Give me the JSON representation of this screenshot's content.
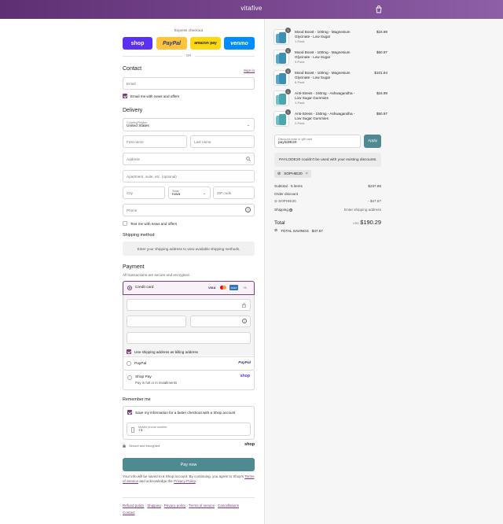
{
  "header": {
    "brand": "vitafive"
  },
  "express": {
    "label": "Express checkout",
    "buttons": {
      "shop": "shop",
      "paypal": "PayPal",
      "amazon": "amazon pay",
      "venmo": "venmo"
    },
    "or": "OR"
  },
  "contact": {
    "title": "Contact",
    "sign_in": "Sign in",
    "email_placeholder": "Email",
    "news_label": "Email me with news and offers"
  },
  "delivery": {
    "title": "Delivery",
    "country_label": "Country/Region",
    "country_value": "United States",
    "first_name": "First name",
    "last_name": "Last name",
    "address": "Address",
    "apartment": "Apartment, suite, etc. (optional)",
    "city": "City",
    "state_label": "State",
    "state_value": "Iowa",
    "zip": "ZIP code",
    "phone": "Phone",
    "text_label": "Text me with news and offers"
  },
  "shipping": {
    "title": "Shipping method",
    "notice": "Enter your shipping address to view available shipping methods."
  },
  "payment": {
    "title": "Payment",
    "subtitle": "All transactions are secure and encrypted.",
    "credit_card": "Credit card",
    "card_badges": {
      "visa": "VISA",
      "amex": "AMEX",
      "more": "+5"
    },
    "billing_label": "Use shipping address as billing address",
    "paypal": "PayPal",
    "paypal_logo": "PayPal",
    "shoppay": "Shop Pay",
    "shoppay_sub": "Pay in full or in installments",
    "shoppay_logo": "shop"
  },
  "remember": {
    "title": "Remember me",
    "save_label": "Save my information for a faster checkout with a Shop account",
    "phone_label": "Mobile phone number",
    "phone_value": "+1",
    "secure": "Secure and encrypted",
    "shop_logo": "shop"
  },
  "pay_now": "Pay now",
  "legal": {
    "text_a": "Your info will be saved to a Shop account. By continuing, you agree to Shop's",
    "terms": "Terms of Service",
    "text_b": "and acknowledge the",
    "privacy": "Privacy Policy",
    "end": "."
  },
  "footer_links": [
    "Refund policy",
    "Shipping",
    "Privacy policy",
    "Terms of service",
    "Cancellations",
    "Contact"
  ],
  "cart": {
    "items": [
      {
        "qty": "1",
        "name": "Mood Boost - 100mg - Magnesium Glycinate - Low Sugar",
        "variant": "1-Pack",
        "price": "$16.99"
      },
      {
        "qty": "1",
        "name": "Mood Boost - 100mg - Magnesium Glycinate - Low Sugar",
        "variant": "3-Pack",
        "price": "$50.97"
      },
      {
        "qty": "1",
        "name": "Mood Boost - 100mg - Magnesium Glycinate - Low Sugar",
        "variant": "6-Pack",
        "price": "$101.94"
      },
      {
        "qty": "1",
        "name": "Anti-Stress - 150mg - Ashwagandha - Low Sugar Gummies",
        "variant": "1-Pack",
        "price": "$16.99"
      },
      {
        "qty": "1",
        "name": "Anti-Stress - 150mg - Ashwagandha - Low Sugar Gummies",
        "variant": "2-Pack",
        "price": "$50.97"
      }
    ],
    "discount_label": "Discount code or gift card",
    "discount_value": "payloDE20",
    "apply": "Apply",
    "error": "PAYLODE20 couldn't be used with your existing discounts.",
    "tag": "SOPHIE20",
    "subtotal_label": "Subtotal · 5 items",
    "subtotal_value": "$237.86",
    "order_discount_label": "Order discount",
    "discount_code": "SOPHIE20",
    "discount_amount": "- $47.57",
    "shipping_label": "Shipping",
    "shipping_value": "Enter shipping address",
    "total_label": "Total",
    "currency": "USD",
    "total_value": "$190.29",
    "savings_label": "TOTAL SAVINGS",
    "savings_value": "$47.57"
  },
  "colors": {
    "brand": "#6b3a80",
    "accent": "#7b3f7e",
    "pay_button": "#4f8a92",
    "shop": "#5a31f4",
    "paypal": "#ffc439",
    "venmo": "#008cff"
  }
}
